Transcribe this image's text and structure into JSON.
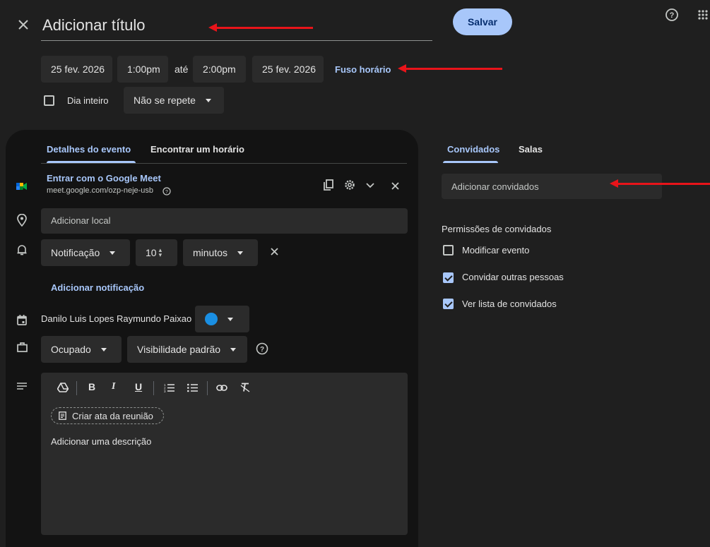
{
  "header": {
    "title_placeholder": "Adicionar título",
    "save_label": "Salvar"
  },
  "datetime": {
    "start_date": "25 fev. 2026",
    "start_time": "1:00pm",
    "until_label": "até",
    "end_time": "2:00pm",
    "end_date": "25 fev. 2026",
    "timezone_link": "Fuso horário",
    "all_day_label": "Dia inteiro",
    "repeat_value": "Não se repete"
  },
  "tabs_left": {
    "details": "Detalhes do evento",
    "find_time": "Encontrar um horário"
  },
  "meet": {
    "title": "Entrar com o Google Meet",
    "link": "meet.google.com/ozp-neje-usb"
  },
  "location": {
    "placeholder": "Adicionar local"
  },
  "notification": {
    "type": "Notificação",
    "amount": "10",
    "unit": "minutos",
    "add_label": "Adicionar notificação"
  },
  "calendar": {
    "owner": "Danilo Luis Lopes Raymundo Paixao",
    "color": "#1a8fe3"
  },
  "availability": {
    "status": "Ocupado",
    "visibility": "Visibilidade padrão"
  },
  "description": {
    "meeting_notes_label": "Criar ata da reunião",
    "placeholder": "Adicionar uma descrição",
    "toolbar": {
      "bold": "B",
      "italic": "I",
      "underline": "U"
    }
  },
  "tabs_right": {
    "guests": "Convidados",
    "rooms": "Salas"
  },
  "guests": {
    "placeholder": "Adicionar convidados",
    "permissions_title": "Permissões de convidados",
    "permissions": [
      {
        "label": "Modificar evento",
        "checked": false
      },
      {
        "label": "Convidar outras pessoas",
        "checked": true
      },
      {
        "label": "Ver lista de convidados",
        "checked": true
      }
    ]
  },
  "colors": {
    "background": "#1f1f1f",
    "panel": "#131313",
    "accent": "#a8c7fa",
    "annotation_arrow": "#e8141a"
  }
}
